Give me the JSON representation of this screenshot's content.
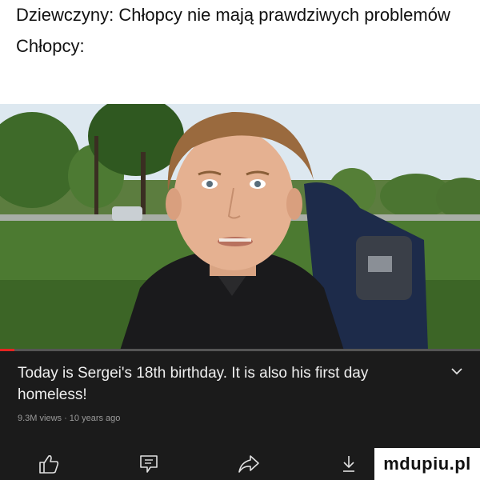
{
  "caption": {
    "line1": "Dziewczyny: Chłopcy nie mają prawdziwych problemów",
    "line2": "Chłopcy:"
  },
  "video": {
    "title": "Today is Sergei's 18th birthday. It is also his first day homeless!",
    "meta": "9.3M views · 10 years ago",
    "progress": 0.03
  },
  "actions": {
    "like_icon": "thumbs-up-icon",
    "comment_icon": "comment-icon",
    "share_icon": "share-icon",
    "download_icon": "download-icon",
    "expand_icon": "chevron-down-icon"
  },
  "watermark": "mdupiu.pl",
  "colors": {
    "info_bg": "#1b1b1b",
    "progress": "#e52421",
    "text_light": "#efefef",
    "text_muted": "#9a9a9a"
  }
}
